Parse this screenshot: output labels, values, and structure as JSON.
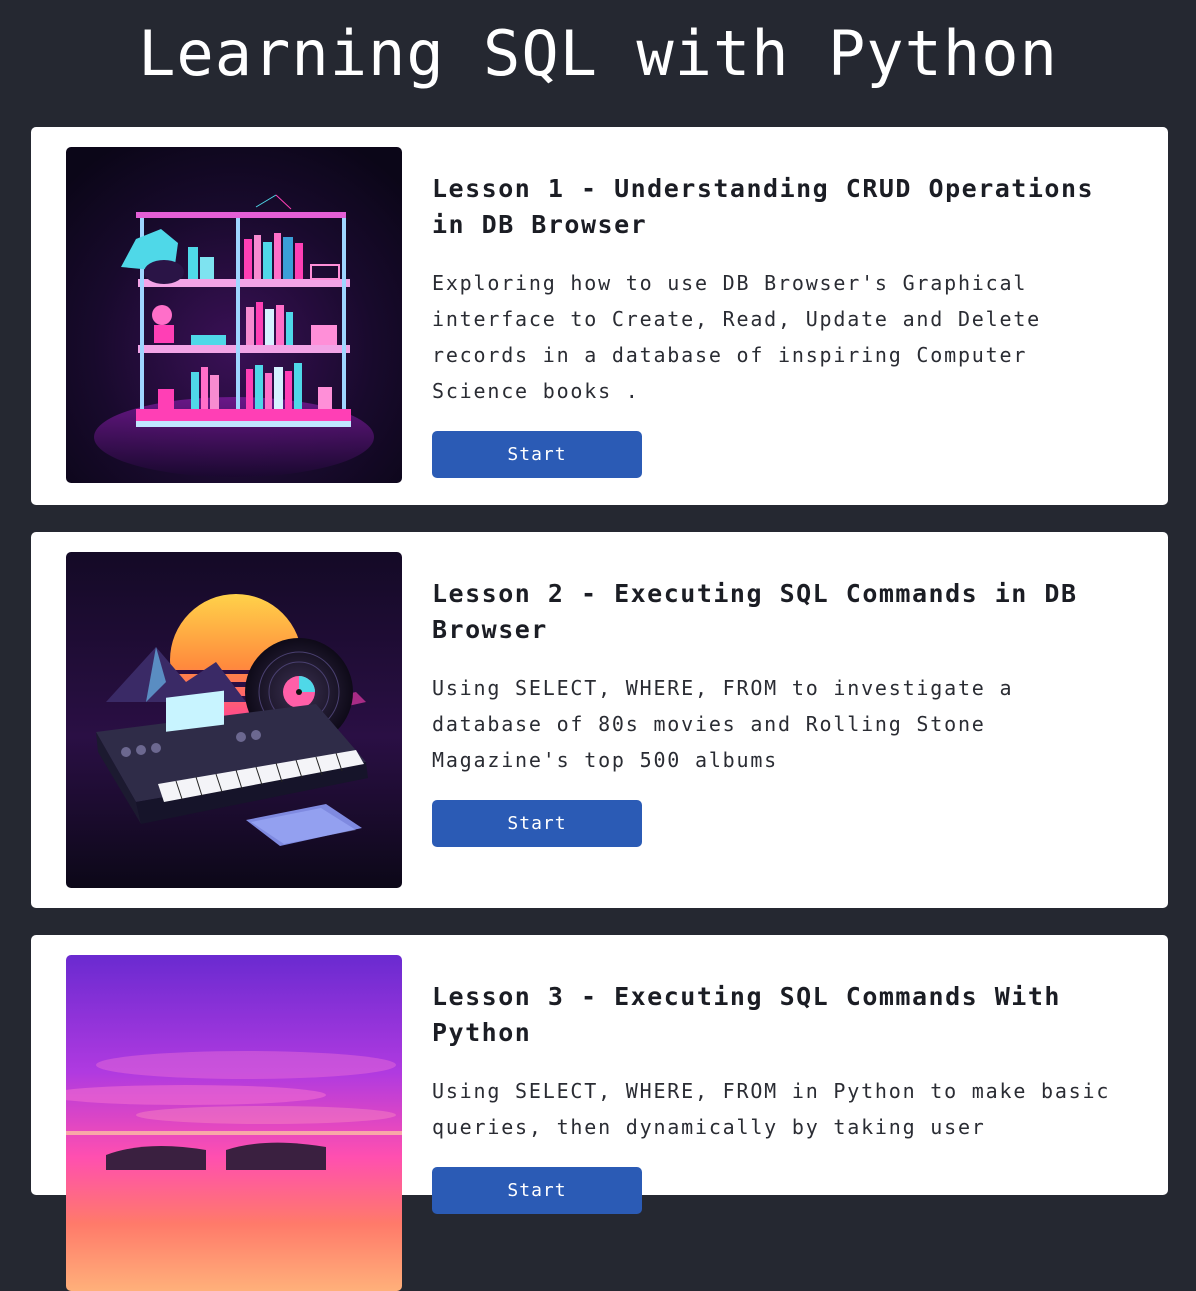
{
  "header": {
    "title": "Learning SQL with Python"
  },
  "lessons": [
    {
      "title": "Lesson 1 - Understanding CRUD Operations in DB Browser",
      "description": "Exploring how to use DB Browser's Graphical interface to Create, Read, Update and Delete records in a database of inspiring Computer Science books .",
      "button_label": "Start",
      "image_icon": "bookshelf-illustration"
    },
    {
      "title": "Lesson 2 - Executing SQL Commands in DB Browser",
      "description": "Using SELECT, WHERE, FROM to investigate a database of 80s movies and Rolling Stone Magazine's top 500 albums",
      "button_label": "Start",
      "image_icon": "synthesizer-vinyl-illustration"
    },
    {
      "title": "Lesson 3 - Executing SQL Commands With Python",
      "description": "Using SELECT, WHERE, FROM in Python to make basic queries, then dynamically by taking user",
      "button_label": "Start",
      "image_icon": "sunset-cars-illustration"
    }
  ],
  "colors": {
    "background": "#252831",
    "card": "#ffffff",
    "button": "#2b5bb5",
    "neon_pink": "#ff3fb5",
    "neon_cyan": "#4fd8e8"
  }
}
